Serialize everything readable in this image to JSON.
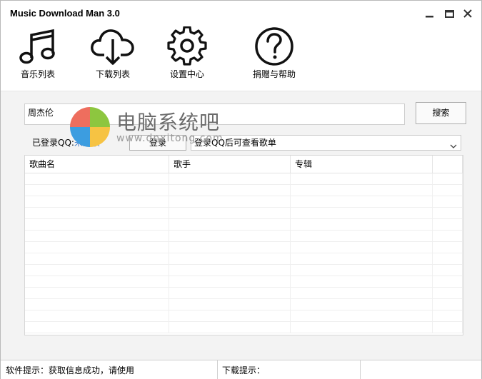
{
  "window": {
    "title": "Music Download Man 3.0",
    "controls": [
      "minimize-icon",
      "maximize-icon",
      "close-icon"
    ]
  },
  "toolbar": {
    "items": [
      {
        "label": "音乐列表",
        "icon": "music-note-icon"
      },
      {
        "label": "下载列表",
        "icon": "cloud-download-icon"
      },
      {
        "label": "设置中心",
        "icon": "gear-icon"
      },
      {
        "label": "捐赠与帮助",
        "icon": "help-icon"
      }
    ]
  },
  "search": {
    "value": "周杰伦",
    "button_label": "搜索"
  },
  "qq": {
    "label": "已登录QQ:",
    "status": "未登录",
    "status_color": "#3a78c8",
    "login_button": "登录",
    "playlist_selected": "登录QQ后可查看歌单"
  },
  "table": {
    "columns": [
      "歌曲名",
      "歌手",
      "专辑"
    ],
    "rows": []
  },
  "statusbar": {
    "software_tip": "软件提示：获取信息成功，请使用",
    "download_tip": "下载提示："
  },
  "watermark": {
    "title": "电脑系统吧",
    "url": "www.dnxitong.com"
  }
}
